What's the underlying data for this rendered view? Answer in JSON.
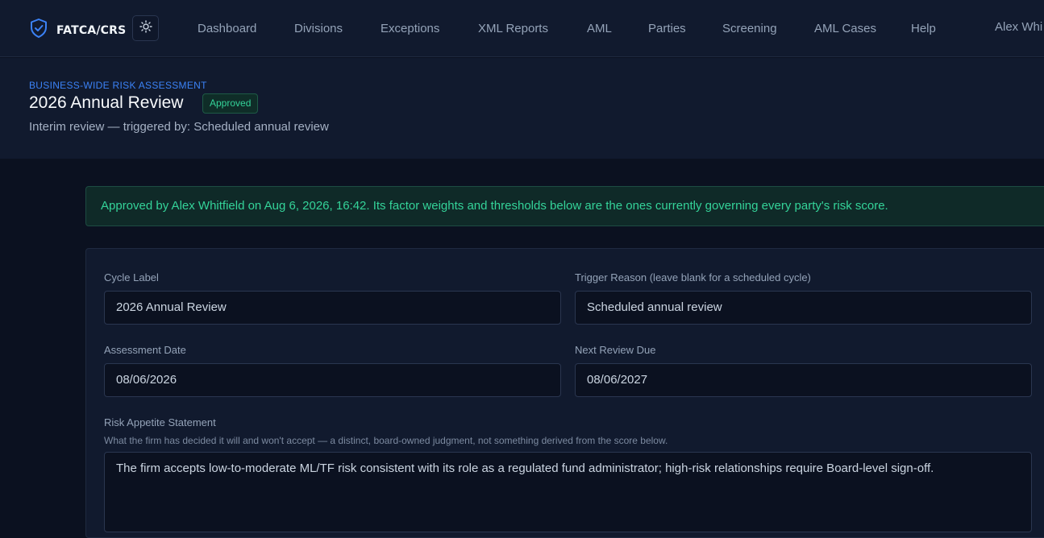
{
  "app": {
    "brand": "FATCA/CRS",
    "user": "Alex Whi"
  },
  "nav": {
    "items": [
      "Dashboard",
      "Divisions",
      "Exceptions",
      "XML Reports",
      "AML",
      "Parties",
      "Screening",
      "AML Cases",
      "Help"
    ]
  },
  "header": {
    "eyebrow": "BUSINESS-WIDE RISK ASSESSMENT",
    "title": "2026 Annual Review",
    "badge": "Approved",
    "subtitle": "Interim review — triggered by: Scheduled annual review"
  },
  "alert": {
    "text": "Approved by Alex Whitfield on Aug 6, 2026, 16:42. Its factor weights and thresholds below are the ones currently governing every party's risk score."
  },
  "form": {
    "cycle_label": {
      "label": "Cycle Label",
      "value": "2026 Annual Review"
    },
    "trigger_reason": {
      "label": "Trigger Reason (leave blank for a scheduled cycle)",
      "value": "Scheduled annual review"
    },
    "assessment_date": {
      "label": "Assessment Date",
      "value": "08/06/2026"
    },
    "next_review_due": {
      "label": "Next Review Due",
      "value": "08/06/2027"
    },
    "risk_appetite": {
      "label": "Risk Appetite Statement",
      "hint": "What the firm has decided it will and won't accept — a distinct, board-owned judgment, not something derived from the score below.",
      "value": "The firm accepts low-to-moderate ML/TF risk consistent with its role as a regulated fund administrator; high-risk relationships require Board-level sign-off."
    }
  },
  "colors": {
    "accent": "#3b82f6",
    "success": "#34d399",
    "background": "#0b1120",
    "surface": "#111a2e"
  },
  "icons": {
    "brand": "shield-check-icon",
    "theme": "sun-icon"
  }
}
